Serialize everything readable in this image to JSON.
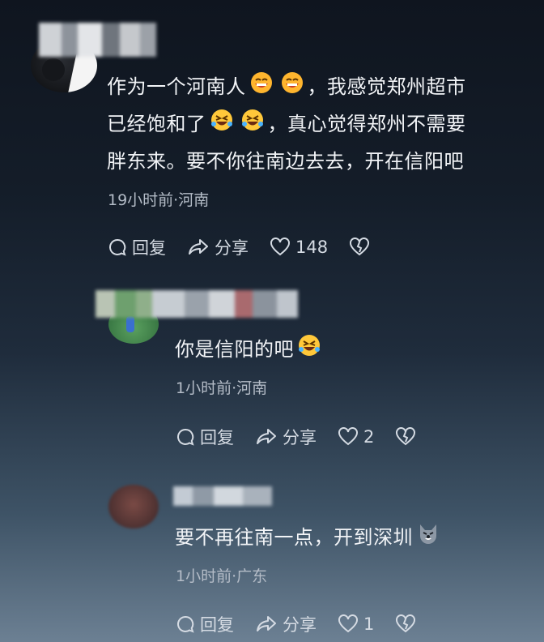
{
  "comments": [
    {
      "text_line1": "作为一个河南人",
      "text_line1b": "，我感觉郑州超市",
      "text_line2": "已经饱和了",
      "text_line2b": "，真心觉得郑州不需要",
      "text_line3": "胖东来。要不你往南边去去，开在信阳吧",
      "meta": "19小时前·河南",
      "reply_label": "回复",
      "share_label": "分享",
      "likes": "148"
    },
    {
      "text": "你是信阳的吧",
      "meta": "1小时前·河南",
      "reply_label": "回复",
      "share_label": "分享",
      "likes": "2"
    },
    {
      "text": "要不再往南一点，开到深圳",
      "meta": "1小时前·广东",
      "reply_label": "回复",
      "share_label": "分享",
      "likes": "1"
    }
  ],
  "icons": {
    "reply": "chat-bubble-icon",
    "share": "share-arrow-icon",
    "like": "heart-icon",
    "dislike": "broken-heart-icon"
  }
}
